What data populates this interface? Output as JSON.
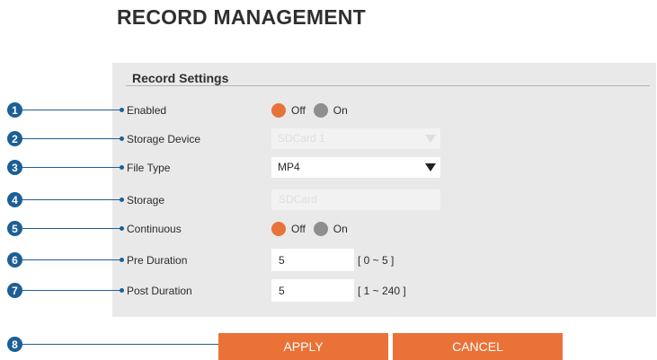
{
  "page": {
    "title": "RECORD MANAGEMENT"
  },
  "section": {
    "title": "Record Settings"
  },
  "rows": {
    "enabled": {
      "marker": "1",
      "label": "Enabled",
      "options": [
        "Off",
        "On"
      ],
      "selected": "Off"
    },
    "storage_device": {
      "marker": "2",
      "label": "Storage Device",
      "value": "SDCard 1",
      "disabled": true
    },
    "file_type": {
      "marker": "3",
      "label": "File Type",
      "value": "MP4",
      "disabled": false
    },
    "storage": {
      "marker": "4",
      "label": "Storage",
      "value": "SDCard",
      "disabled": true
    },
    "continuous": {
      "marker": "5",
      "label": "Continuous",
      "options": [
        "Off",
        "On"
      ],
      "selected": "Off"
    },
    "pre_duration": {
      "marker": "6",
      "label": "Pre Duration",
      "value": "5",
      "range": "[ 0 ~ 5 ]"
    },
    "post_duration": {
      "marker": "7",
      "label": "Post Duration",
      "value": "5",
      "range": "[ 1 ~ 240 ]"
    }
  },
  "buttons": {
    "marker": "8",
    "apply": "APPLY",
    "cancel": "CANCEL"
  },
  "colors": {
    "accent": "#ea7237",
    "marker": "#1c5f96",
    "panel": "#e9e9e9",
    "radio_off": "#8e8e8e"
  },
  "icons": {
    "dropdown": "chevron-down-icon"
  }
}
